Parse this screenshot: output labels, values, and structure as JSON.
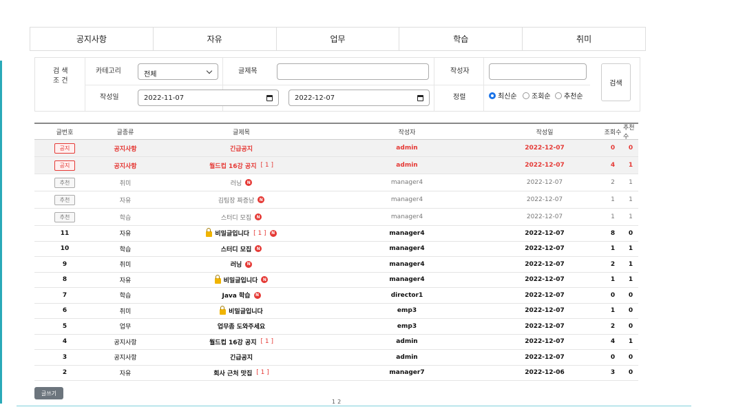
{
  "categories": [
    "공지사항",
    "자유",
    "업무",
    "학습",
    "취미"
  ],
  "search": {
    "condition_label_1": "검 색",
    "condition_label_2": "조 건",
    "category_label": "카테고리",
    "category_value": "전체",
    "title_label": "글제목",
    "title_value": "",
    "writer_label": "작성자",
    "writer_value": "",
    "date_label": "작성일",
    "date_from": "2022-11-07",
    "date_to": "2022-12-07",
    "sort_label": "정렬",
    "sort_options": [
      "최신순",
      "조회순",
      "추천순"
    ],
    "sort_selected": "최신순",
    "search_button": "검색"
  },
  "table": {
    "headers": [
      "글번호",
      "글종류",
      "글제목",
      "작성자",
      "작성일",
      "조회수",
      "추천수"
    ],
    "rows": [
      {
        "no": "공지",
        "type": "공지사항",
        "title": "긴급공지",
        "writer": "admin",
        "date": "2022-12-07",
        "views": "0",
        "likes": "0",
        "kind": "notice",
        "lock": false,
        "comments": "",
        "new": false
      },
      {
        "no": "공지",
        "type": "공지사항",
        "title": "월드컵 16강 공지",
        "writer": "admin",
        "date": "2022-12-07",
        "views": "4",
        "likes": "1",
        "kind": "notice",
        "lock": false,
        "comments": "[ 1 ]",
        "new": false
      },
      {
        "no": "추천",
        "type": "취미",
        "title": "러닝",
        "writer": "manager4",
        "date": "2022-12-07",
        "views": "2",
        "likes": "1",
        "kind": "rec",
        "lock": false,
        "comments": "",
        "new": true
      },
      {
        "no": "추천",
        "type": "자유",
        "title": "김팀장 짜증남",
        "writer": "manager4",
        "date": "2022-12-07",
        "views": "1",
        "likes": "1",
        "kind": "rec",
        "lock": false,
        "comments": "",
        "new": true
      },
      {
        "no": "추천",
        "type": "학습",
        "title": "스터디 모집",
        "writer": "manager4",
        "date": "2022-12-07",
        "views": "1",
        "likes": "1",
        "kind": "rec",
        "lock": false,
        "comments": "",
        "new": true
      },
      {
        "no": "11",
        "type": "자유",
        "title": "비밀글입니다",
        "writer": "manager4",
        "date": "2022-12-07",
        "views": "8",
        "likes": "0",
        "kind": "plain",
        "lock": true,
        "comments": "[ 1 ]",
        "new": true
      },
      {
        "no": "10",
        "type": "학습",
        "title": "스터디 모집",
        "writer": "manager4",
        "date": "2022-12-07",
        "views": "1",
        "likes": "1",
        "kind": "plain",
        "lock": false,
        "comments": "",
        "new": true
      },
      {
        "no": "9",
        "type": "취미",
        "title": "러닝",
        "writer": "manager4",
        "date": "2022-12-07",
        "views": "2",
        "likes": "1",
        "kind": "plain",
        "lock": false,
        "comments": "",
        "new": true
      },
      {
        "no": "8",
        "type": "자유",
        "title": "비밀글입니다",
        "writer": "manager4",
        "date": "2022-12-07",
        "views": "1",
        "likes": "1",
        "kind": "plain",
        "lock": true,
        "comments": "",
        "new": true
      },
      {
        "no": "7",
        "type": "학습",
        "title": "Java 학습",
        "writer": "director1",
        "date": "2022-12-07",
        "views": "0",
        "likes": "0",
        "kind": "plain",
        "lock": false,
        "comments": "",
        "new": true
      },
      {
        "no": "6",
        "type": "취미",
        "title": "비밀글입니다",
        "writer": "emp3",
        "date": "2022-12-07",
        "views": "1",
        "likes": "0",
        "kind": "plain",
        "lock": true,
        "comments": "",
        "new": false
      },
      {
        "no": "5",
        "type": "업무",
        "title": "업무좀 도와주세요",
        "writer": "emp3",
        "date": "2022-12-07",
        "views": "2",
        "likes": "0",
        "kind": "plain",
        "lock": false,
        "comments": "",
        "new": false
      },
      {
        "no": "4",
        "type": "공지사항",
        "title": "월드컵 16강 공지",
        "writer": "admin",
        "date": "2022-12-07",
        "views": "4",
        "likes": "1",
        "kind": "plain",
        "lock": false,
        "comments": "[ 1 ]",
        "new": false
      },
      {
        "no": "3",
        "type": "공지사항",
        "title": "긴급공지",
        "writer": "admin",
        "date": "2022-12-07",
        "views": "0",
        "likes": "0",
        "kind": "plain",
        "lock": false,
        "comments": "",
        "new": false
      },
      {
        "no": "2",
        "type": "자유",
        "title": "회사 근처 맛집",
        "writer": "manager7",
        "date": "2022-12-06",
        "views": "3",
        "likes": "0",
        "kind": "plain",
        "lock": false,
        "comments": "[ 1 ]",
        "new": false
      }
    ]
  },
  "new_mark": "N",
  "write_button": "글쓰기",
  "pages": [
    "1",
    "2"
  ],
  "colors": {
    "accent": "#2aa9b8",
    "notice": "#e53935",
    "radio": "#1a73e8",
    "button": "#6c757d"
  }
}
